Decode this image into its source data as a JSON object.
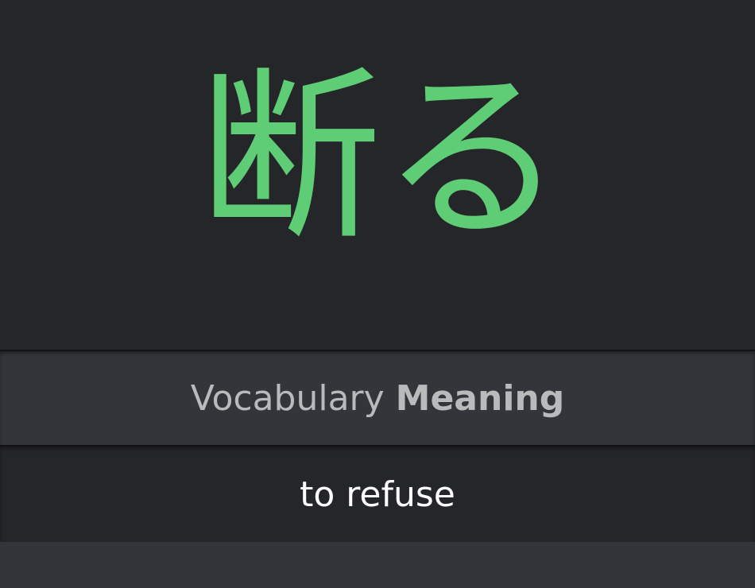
{
  "item": {
    "characters": "断る",
    "color": "#5fcd75"
  },
  "question": {
    "type_label": "Vocabulary",
    "mode_label": "Meaning"
  },
  "answer": {
    "value": "to refuse"
  }
}
